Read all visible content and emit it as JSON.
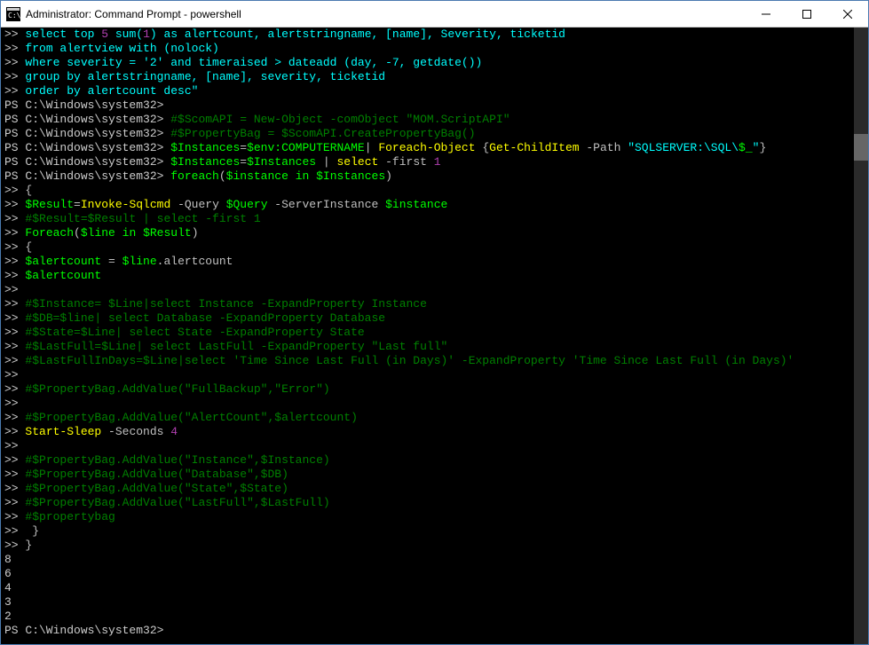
{
  "titlebar": {
    "title": "Administrator: Command Prompt - powershell"
  },
  "prompt": "PS C:\\Windows\\system32>",
  "cont": ">>",
  "lines": [
    {
      "prefix": ">>",
      "segs": [
        {
          "t": " ",
          "c": "c-gray"
        },
        {
          "t": "select top ",
          "c": "c-blue"
        },
        {
          "t": "5",
          "c": "c-purple"
        },
        {
          "t": " sum(",
          "c": "c-blue"
        },
        {
          "t": "1",
          "c": "c-purple"
        },
        {
          "t": ") as alertcount, alertstringname, [name], Severity, ticketid",
          "c": "c-blue"
        }
      ]
    },
    {
      "prefix": ">>",
      "segs": [
        {
          "t": " from alertview with (nolock)",
          "c": "c-blue"
        }
      ]
    },
    {
      "prefix": ">>",
      "segs": [
        {
          "t": " where severity = '2' and timeraised > dateadd (day, -7, getdate())",
          "c": "c-blue"
        }
      ]
    },
    {
      "prefix": ">>",
      "segs": [
        {
          "t": " group by alertstringname, [name], severity, ticketid",
          "c": "c-blue"
        }
      ]
    },
    {
      "prefix": ">>",
      "segs": [
        {
          "t": " order by alertcount desc\"",
          "c": "c-blue"
        }
      ]
    },
    {
      "prefix": "PS C:\\Windows\\system32>",
      "segs": []
    },
    {
      "prefix": "PS C:\\Windows\\system32>",
      "segs": [
        {
          "t": " ",
          "c": "c-gray"
        },
        {
          "t": "#$ScomAPI = New-Object -comObject \"MOM.ScriptAPI\"",
          "c": "c-dgreen"
        }
      ]
    },
    {
      "prefix": "PS C:\\Windows\\system32>",
      "segs": [
        {
          "t": " ",
          "c": "c-gray"
        },
        {
          "t": "#$PropertyBag = $ScomAPI.CreatePropertyBag()",
          "c": "c-dgreen"
        }
      ]
    },
    {
      "prefix": "PS C:\\Windows\\system32>",
      "segs": [
        {
          "t": " ",
          "c": "c-gray"
        },
        {
          "t": "$Instances",
          "c": "c-green"
        },
        {
          "t": "=",
          "c": "c-gray"
        },
        {
          "t": "$env:COMPUTERNAME",
          "c": "c-green"
        },
        {
          "t": "|",
          "c": "c-gray"
        },
        {
          "t": " Foreach-Object ",
          "c": "c-yellow"
        },
        {
          "t": "{",
          "c": "c-gray"
        },
        {
          "t": "Get-ChildItem",
          "c": "c-yellow"
        },
        {
          "t": " -Path ",
          "c": "c-gray"
        },
        {
          "t": "\"SQLSERVER:\\SQL\\",
          "c": "c-blue"
        },
        {
          "t": "$_",
          "c": "c-green"
        },
        {
          "t": "\"",
          "c": "c-blue"
        },
        {
          "t": "}",
          "c": "c-gray"
        }
      ]
    },
    {
      "prefix": "PS C:\\Windows\\system32>",
      "segs": [
        {
          "t": " ",
          "c": "c-gray"
        },
        {
          "t": "$Instances",
          "c": "c-green"
        },
        {
          "t": "=",
          "c": "c-gray"
        },
        {
          "t": "$Instances",
          "c": "c-green"
        },
        {
          "t": " | ",
          "c": "c-gray"
        },
        {
          "t": "select",
          "c": "c-yellow"
        },
        {
          "t": " -first ",
          "c": "c-gray"
        },
        {
          "t": "1",
          "c": "c-purple"
        }
      ]
    },
    {
      "prefix": "PS C:\\Windows\\system32>",
      "segs": [
        {
          "t": " ",
          "c": "c-gray"
        },
        {
          "t": "foreach",
          "c": "c-green"
        },
        {
          "t": "(",
          "c": "c-gray"
        },
        {
          "t": "$instance",
          "c": "c-green"
        },
        {
          "t": " in ",
          "c": "c-green"
        },
        {
          "t": "$Instances",
          "c": "c-green"
        },
        {
          "t": ")",
          "c": "c-gray"
        }
      ]
    },
    {
      "prefix": ">>",
      "segs": [
        {
          "t": " {",
          "c": "c-gray"
        }
      ]
    },
    {
      "prefix": ">>",
      "segs": [
        {
          "t": " ",
          "c": "c-gray"
        },
        {
          "t": "$Result",
          "c": "c-green"
        },
        {
          "t": "=",
          "c": "c-gray"
        },
        {
          "t": "Invoke-Sqlcmd",
          "c": "c-yellow"
        },
        {
          "t": " -Query ",
          "c": "c-gray"
        },
        {
          "t": "$Query",
          "c": "c-green"
        },
        {
          "t": " -ServerInstance ",
          "c": "c-gray"
        },
        {
          "t": "$instance",
          "c": "c-green"
        }
      ]
    },
    {
      "prefix": ">>",
      "segs": [
        {
          "t": " ",
          "c": "c-gray"
        },
        {
          "t": "#$Result=$Result | select -first 1",
          "c": "c-dgreen"
        }
      ]
    },
    {
      "prefix": ">>",
      "segs": [
        {
          "t": " ",
          "c": "c-gray"
        },
        {
          "t": "Foreach",
          "c": "c-green"
        },
        {
          "t": "(",
          "c": "c-gray"
        },
        {
          "t": "$line",
          "c": "c-green"
        },
        {
          "t": " in ",
          "c": "c-green"
        },
        {
          "t": "$Result",
          "c": "c-green"
        },
        {
          "t": ")",
          "c": "c-gray"
        }
      ]
    },
    {
      "prefix": ">>",
      "segs": [
        {
          "t": " {",
          "c": "c-gray"
        }
      ]
    },
    {
      "prefix": ">>",
      "segs": [
        {
          "t": " ",
          "c": "c-gray"
        },
        {
          "t": "$alertcount",
          "c": "c-green"
        },
        {
          "t": " = ",
          "c": "c-gray"
        },
        {
          "t": "$line",
          "c": "c-green"
        },
        {
          "t": ".alertcount",
          "c": "c-gray"
        }
      ]
    },
    {
      "prefix": ">>",
      "segs": [
        {
          "t": " ",
          "c": "c-gray"
        },
        {
          "t": "$alertcount",
          "c": "c-green"
        }
      ]
    },
    {
      "prefix": ">>",
      "segs": []
    },
    {
      "prefix": ">>",
      "segs": [
        {
          "t": " ",
          "c": "c-gray"
        },
        {
          "t": "#$Instance= $Line|select Instance -ExpandProperty Instance",
          "c": "c-dgreen"
        }
      ]
    },
    {
      "prefix": ">>",
      "segs": [
        {
          "t": " ",
          "c": "c-gray"
        },
        {
          "t": "#$DB=$line| select Database -ExpandProperty Database",
          "c": "c-dgreen"
        }
      ]
    },
    {
      "prefix": ">>",
      "segs": [
        {
          "t": " ",
          "c": "c-gray"
        },
        {
          "t": "#$State=$Line| select State -ExpandProperty State",
          "c": "c-dgreen"
        }
      ]
    },
    {
      "prefix": ">>",
      "segs": [
        {
          "t": " ",
          "c": "c-gray"
        },
        {
          "t": "#$LastFull=$Line| select LastFull -ExpandProperty \"Last full\"",
          "c": "c-dgreen"
        }
      ]
    },
    {
      "prefix": ">>",
      "segs": [
        {
          "t": " ",
          "c": "c-gray"
        },
        {
          "t": "#$LastFullInDays=$Line|select 'Time Since Last Full (in Days)' -ExpandProperty 'Time Since Last Full (in Days)'",
          "c": "c-dgreen"
        }
      ]
    },
    {
      "prefix": ">>",
      "segs": []
    },
    {
      "prefix": ">>",
      "segs": [
        {
          "t": " ",
          "c": "c-gray"
        },
        {
          "t": "#$PropertyBag.AddValue(\"FullBackup\",\"Error\")",
          "c": "c-dgreen"
        }
      ]
    },
    {
      "prefix": ">>",
      "segs": []
    },
    {
      "prefix": ">>",
      "segs": [
        {
          "t": " ",
          "c": "c-gray"
        },
        {
          "t": "#$PropertyBag.AddValue(\"AlertCount\",$alertcount)",
          "c": "c-dgreen"
        }
      ]
    },
    {
      "prefix": ">>",
      "segs": [
        {
          "t": " ",
          "c": "c-gray"
        },
        {
          "t": "Start-Sleep",
          "c": "c-yellow"
        },
        {
          "t": " -Seconds ",
          "c": "c-gray"
        },
        {
          "t": "4",
          "c": "c-purple"
        }
      ]
    },
    {
      "prefix": ">>",
      "segs": []
    },
    {
      "prefix": ">>",
      "segs": [
        {
          "t": " ",
          "c": "c-gray"
        },
        {
          "t": "#$PropertyBag.AddValue(\"Instance\",$Instance)",
          "c": "c-dgreen"
        }
      ]
    },
    {
      "prefix": ">>",
      "segs": [
        {
          "t": " ",
          "c": "c-gray"
        },
        {
          "t": "#$PropertyBag.AddValue(\"Database\",$DB)",
          "c": "c-dgreen"
        }
      ]
    },
    {
      "prefix": ">>",
      "segs": [
        {
          "t": " ",
          "c": "c-gray"
        },
        {
          "t": "#$PropertyBag.AddValue(\"State\",$State)",
          "c": "c-dgreen"
        }
      ]
    },
    {
      "prefix": ">>",
      "segs": [
        {
          "t": " ",
          "c": "c-gray"
        },
        {
          "t": "#$PropertyBag.AddValue(\"LastFull\",$LastFull)",
          "c": "c-dgreen"
        }
      ]
    },
    {
      "prefix": ">>",
      "segs": [
        {
          "t": " ",
          "c": "c-gray"
        },
        {
          "t": "#$propertybag",
          "c": "c-dgreen"
        }
      ]
    },
    {
      "prefix": ">>",
      "segs": [
        {
          "t": "  }",
          "c": "c-gray"
        }
      ]
    },
    {
      "prefix": ">>",
      "segs": [
        {
          "t": " }",
          "c": "c-gray"
        }
      ]
    },
    {
      "prefix": "",
      "segs": [
        {
          "t": "8",
          "c": "c-white"
        }
      ]
    },
    {
      "prefix": "",
      "segs": [
        {
          "t": "6",
          "c": "c-white"
        }
      ]
    },
    {
      "prefix": "",
      "segs": [
        {
          "t": "4",
          "c": "c-white"
        }
      ]
    },
    {
      "prefix": "",
      "segs": [
        {
          "t": "3",
          "c": "c-white"
        }
      ]
    },
    {
      "prefix": "",
      "segs": [
        {
          "t": "2",
          "c": "c-white"
        }
      ]
    },
    {
      "prefix": "PS C:\\Windows\\system32>",
      "segs": []
    }
  ]
}
